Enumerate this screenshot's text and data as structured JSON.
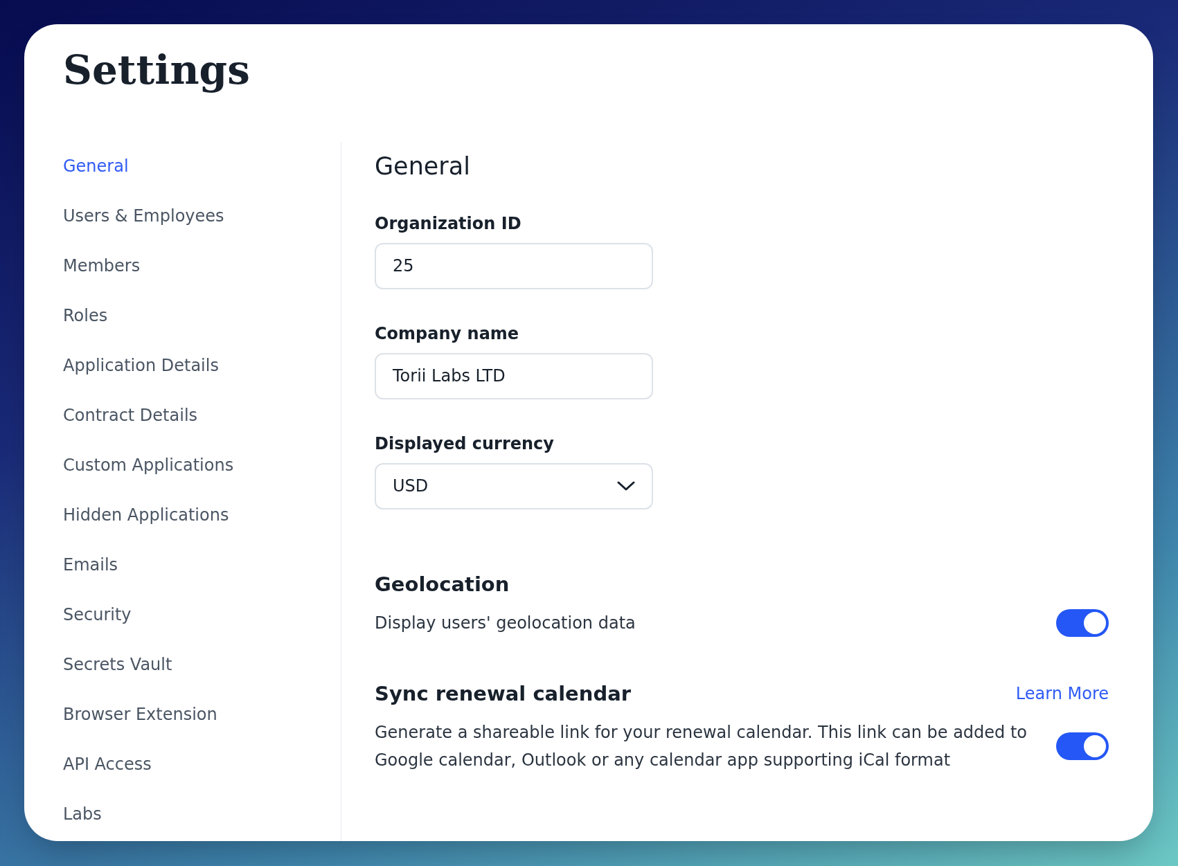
{
  "title": "Settings",
  "sidebar": {
    "items": [
      {
        "label": "General",
        "selected": true
      },
      {
        "label": "Users & Employees",
        "selected": false
      },
      {
        "label": "Members",
        "selected": false
      },
      {
        "label": "Roles",
        "selected": false
      },
      {
        "label": "Application Details",
        "selected": false
      },
      {
        "label": "Contract Details",
        "selected": false
      },
      {
        "label": "Custom Applications",
        "selected": false
      },
      {
        "label": "Hidden Applications",
        "selected": false
      },
      {
        "label": "Emails",
        "selected": false
      },
      {
        "label": "Security",
        "selected": false
      },
      {
        "label": "Secrets Vault",
        "selected": false
      },
      {
        "label": "Browser Extension",
        "selected": false
      },
      {
        "label": "API Access",
        "selected": false
      },
      {
        "label": "Labs",
        "selected": false
      }
    ]
  },
  "content": {
    "heading": "General",
    "fields": [
      {
        "kind": "text",
        "label": "Organization ID",
        "value": "25"
      },
      {
        "kind": "text",
        "label": "Company name",
        "value": "Torii Labs LTD"
      },
      {
        "kind": "select",
        "label": "Displayed currency",
        "value": "USD"
      }
    ],
    "sections": [
      {
        "heading": "Geolocation",
        "description": "Display users' geolocation data",
        "on": true
      },
      {
        "heading": "Sync renewal calendar",
        "link": "Learn More",
        "description": "Generate a shareable link for your renewal calendar. This link can be added to Google calendar, Outlook or any calendar app supporting iCal format",
        "on": true
      }
    ]
  }
}
